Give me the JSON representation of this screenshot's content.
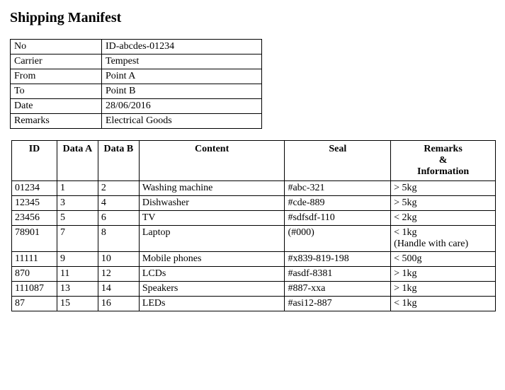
{
  "title": "Shipping Manifest",
  "meta": {
    "rows": [
      {
        "key": "No",
        "value": "ID-abcdes-01234"
      },
      {
        "key": "Carrier",
        "value": "Tempest"
      },
      {
        "key": "From",
        "value": "Point A"
      },
      {
        "key": "To",
        "value": "Point B"
      },
      {
        "key": "Date",
        "value": "28/06/2016"
      },
      {
        "key": "Remarks",
        "value": "Electrical Goods"
      }
    ]
  },
  "items": {
    "headers": {
      "id": "ID",
      "dataA": "Data A",
      "dataB": "Data B",
      "content": "Content",
      "seal": "Seal",
      "remarks": "Remarks\n&\nInformation"
    },
    "rows": [
      {
        "id": "01234",
        "dataA": "1",
        "dataB": "2",
        "content": "Washing machine",
        "seal": "#abc-321",
        "remarks": "> 5kg"
      },
      {
        "id": "12345",
        "dataA": "3",
        "dataB": "4",
        "content": "Dishwasher",
        "seal": "#cde-889",
        "remarks": "> 5kg"
      },
      {
        "id": "23456",
        "dataA": "5",
        "dataB": "6",
        "content": "TV",
        "seal": "#sdfsdf-110",
        "remarks": "< 2kg"
      },
      {
        "id": "78901",
        "dataA": "7",
        "dataB": "8",
        "content": "Laptop",
        "seal": "(#000)",
        "remarks": "< 1kg\n(Handle with care)"
      },
      {
        "id": "11111",
        "dataA": "9",
        "dataB": "10",
        "content": "Mobile phones",
        "seal": "#x839-819-198",
        "remarks": "< 500g"
      },
      {
        "id": "870",
        "dataA": "11",
        "dataB": "12",
        "content": "LCDs",
        "seal": "#asdf-8381",
        "remarks": "> 1kg"
      },
      {
        "id": "111087",
        "dataA": "13",
        "dataB": "14",
        "content": "Speakers",
        "seal": "#887-xxa",
        "remarks": "> 1kg"
      },
      {
        "id": "87",
        "dataA": "15",
        "dataB": "16",
        "content": "LEDs",
        "seal": "#asi12-887",
        "remarks": "< 1kg"
      }
    ]
  }
}
